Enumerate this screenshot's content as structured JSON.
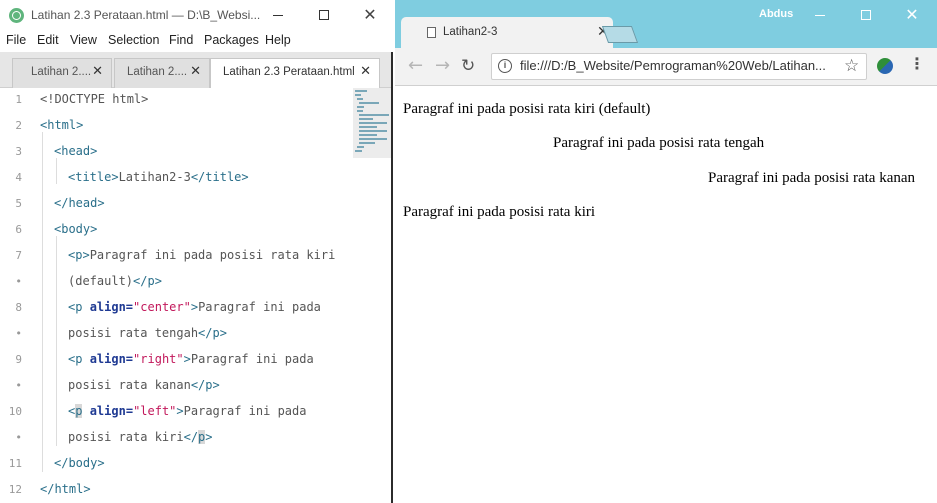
{
  "atom": {
    "title": "Latihan 2.3 Perataan.html — D:\\B_Websi...",
    "menu": [
      "File",
      "Edit",
      "View",
      "Selection",
      "Find",
      "Packages",
      "Help"
    ],
    "tabs": [
      {
        "label": "Latihan 2...."
      },
      {
        "label": "Latihan 2...."
      },
      {
        "label": "Latihan 2.3 Perataan.html",
        "active": true
      }
    ],
    "line_numbers": [
      "1",
      "2",
      "3",
      "4",
      "5",
      "6",
      "7",
      "•",
      "8",
      "•",
      "9",
      "•",
      "10",
      "•",
      "11",
      "12"
    ],
    "code": {
      "l1": "<!DOCTYPE html>",
      "l2_tag": "<html>",
      "l3_tag": "<head>",
      "l4_open": "<title>",
      "l4_text": "Latihan2-3",
      "l4_close": "</title>",
      "l5_tag": "</head>",
      "l6_tag": "<body>",
      "l7_open": "<p>",
      "l7_text": "Paragraf ini pada posisi rata kiri",
      "l7b_text": "(default)",
      "l7b_close": "</p>",
      "l8_open": "<p",
      "l8_attr": "align=",
      "l8_val": "\"center\"",
      "l8_gt": ">",
      "l8_text": "Paragraf ini pada",
      "l8b_text": "posisi rata tengah",
      "l8b_close": "</p>",
      "l9_open": "<p",
      "l9_attr": "align=",
      "l9_val": "\"right\"",
      "l9_gt": ">",
      "l9_text": "Paragraf ini pada",
      "l9b_text": "posisi rata kanan",
      "l9b_close": "</p>",
      "l10_lt": "<",
      "l10_p": "p",
      "l10_attr": "align=",
      "l10_val": "\"left\"",
      "l10_gt": ">",
      "l10_text": "Paragraf ini pada",
      "l10b_text": "posisi rata kiri",
      "l10b_close_a": "</",
      "l10b_close_p": "p",
      "l10b_close_b": ">",
      "l11_tag": "</body>",
      "l12_tag": "</html>"
    }
  },
  "chrome": {
    "user": "Abdus",
    "tab_label": "Latihan2-3",
    "url": "file:///D:/B_Website/Pemrograman%20Web/Latihan...",
    "paragraphs": {
      "p1": "Paragraf ini pada posisi rata kiri (default)",
      "p2": "Paragraf ini pada posisi rata tengah",
      "p3": "Paragraf ini pada posisi rata kanan",
      "p4": "Paragraf ini pada posisi rata kiri"
    }
  }
}
